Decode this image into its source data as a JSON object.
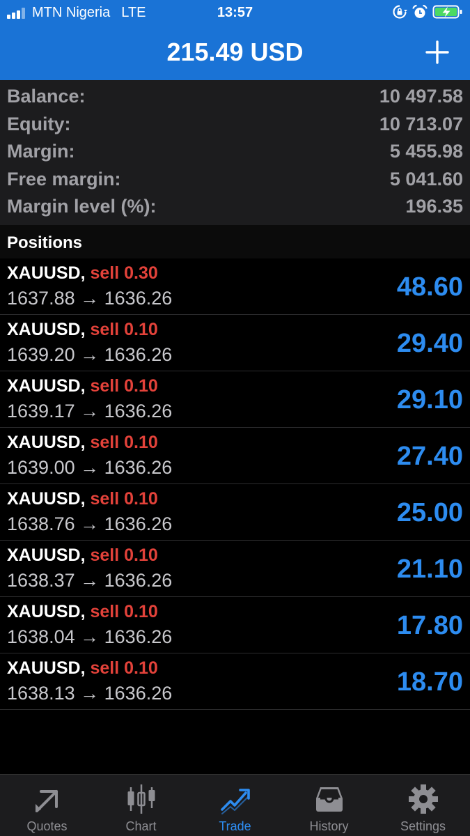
{
  "status_bar": {
    "carrier": "MTN Nigeria",
    "network": "LTE",
    "time": "13:57",
    "battery_icon": "battery-charging-icon"
  },
  "header": {
    "title": "215.49 USD",
    "add_icon": "plus-icon"
  },
  "account": {
    "rows": [
      {
        "label": "Balance:",
        "value": "10 497.58"
      },
      {
        "label": "Equity:",
        "value": "10 713.07"
      },
      {
        "label": "Margin:",
        "value": "5 455.98"
      },
      {
        "label": "Free margin:",
        "value": "5 041.60"
      },
      {
        "label": "Margin level (%):",
        "value": "196.35"
      }
    ]
  },
  "positions": {
    "title": "Positions",
    "items": [
      {
        "symbol": "XAUUSD,",
        "side": "sell 0.30",
        "open": "1637.88",
        "arrow": "→",
        "current": "1636.26",
        "profit": "48.60"
      },
      {
        "symbol": "XAUUSD,",
        "side": "sell 0.10",
        "open": "1639.20",
        "arrow": "→",
        "current": "1636.26",
        "profit": "29.40"
      },
      {
        "symbol": "XAUUSD,",
        "side": "sell 0.10",
        "open": "1639.17",
        "arrow": "→",
        "current": "1636.26",
        "profit": "29.10"
      },
      {
        "symbol": "XAUUSD,",
        "side": "sell 0.10",
        "open": "1639.00",
        "arrow": "→",
        "current": "1636.26",
        "profit": "27.40"
      },
      {
        "symbol": "XAUUSD,",
        "side": "sell 0.10",
        "open": "1638.76",
        "arrow": "→",
        "current": "1636.26",
        "profit": "25.00"
      },
      {
        "symbol": "XAUUSD,",
        "side": "sell 0.10",
        "open": "1638.37",
        "arrow": "→",
        "current": "1636.26",
        "profit": "21.10"
      },
      {
        "symbol": "XAUUSD,",
        "side": "sell 0.10",
        "open": "1638.04",
        "arrow": "→",
        "current": "1636.26",
        "profit": "17.80"
      },
      {
        "symbol": "XAUUSD,",
        "side": "sell 0.10",
        "open": "1638.13",
        "arrow": "→",
        "current": "1636.26",
        "profit": "18.70"
      }
    ]
  },
  "tabs": [
    {
      "label": "Quotes",
      "icon": "quotes-icon",
      "active": false
    },
    {
      "label": "Chart",
      "icon": "candlestick-icon",
      "active": false
    },
    {
      "label": "Trade",
      "icon": "trade-icon",
      "active": true
    },
    {
      "label": "History",
      "icon": "inbox-icon",
      "active": false
    },
    {
      "label": "Settings",
      "icon": "gear-icon",
      "active": false
    }
  ],
  "colors": {
    "header_bg": "#1a73d6",
    "sell": "#e3423a",
    "profit": "#2d8cf0",
    "active_tab": "#2d8cf0"
  }
}
